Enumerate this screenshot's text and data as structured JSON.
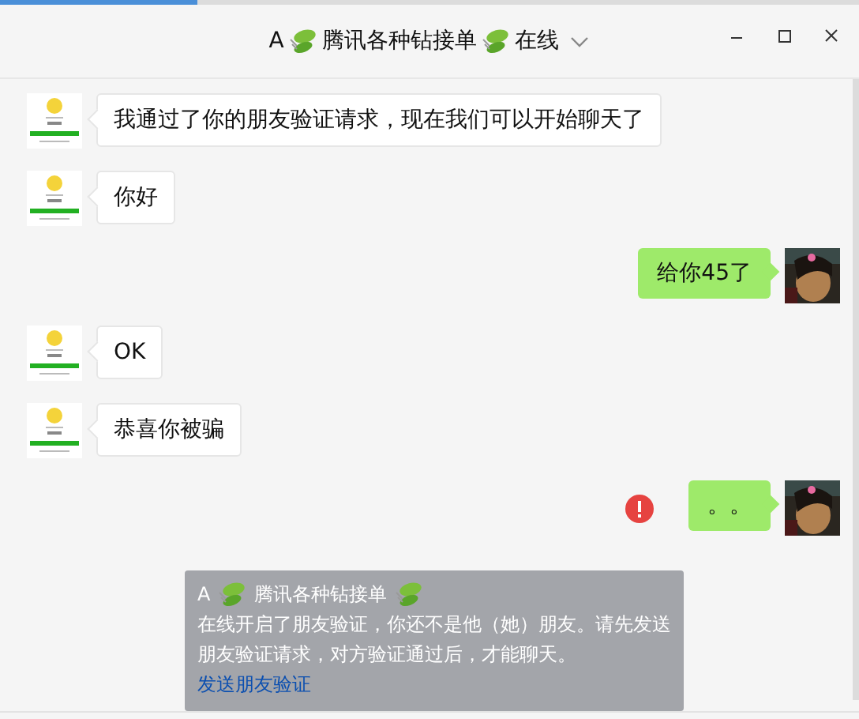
{
  "loading": {
    "level": 0.23
  },
  "title": {
    "name_prefix": "A",
    "name": "腾讯各种钻接单",
    "status": "在线"
  },
  "messages": [
    {
      "kind": "received",
      "text": "我通过了你的朋友验证请求，现在我们可以开始聊天了",
      "failed": false
    },
    {
      "kind": "received",
      "text": "你好",
      "failed": false
    },
    {
      "kind": "sent",
      "text": "给你45了",
      "failed": false
    },
    {
      "kind": "received",
      "text": "OK",
      "failed": false
    },
    {
      "kind": "received",
      "text": "恭喜你被骗",
      "failed": false
    },
    {
      "kind": "sent",
      "text": "。。",
      "failed": true
    }
  ],
  "notice": {
    "name_prefix": "A",
    "name": "腾讯各种钻接单",
    "text": "在线开启了朋友验证，你还不是他（她）朋友。请先发送朋友验证请求，对方验证通过后，才能聊天。",
    "link": "发送朋友验证"
  }
}
